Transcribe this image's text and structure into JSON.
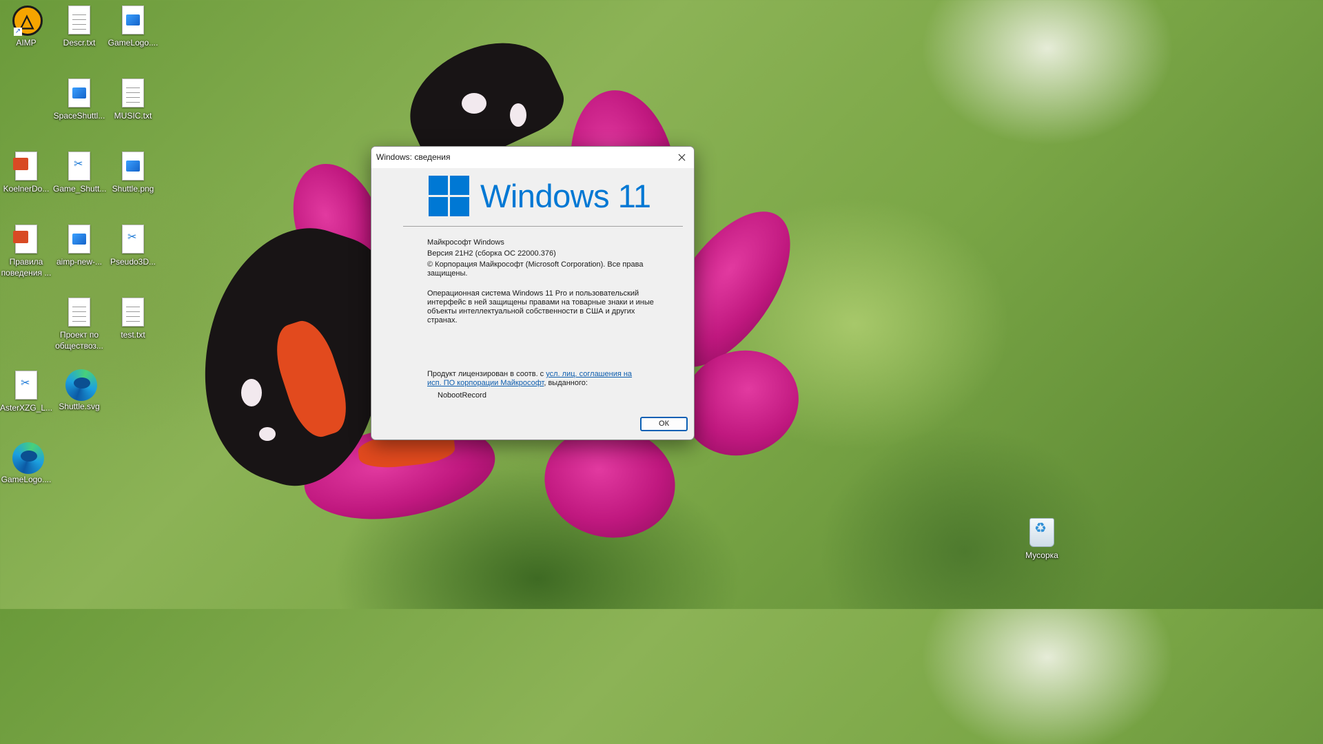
{
  "desktop": {
    "icons": [
      {
        "label": "AIMP",
        "icon": "aimp-icon"
      },
      {
        "label": "Descr.txt",
        "icon": "text-file-icon"
      },
      {
        "label": "GameLogo....",
        "icon": "image-file-icon"
      },
      {
        "label": "SpaceShuttl...",
        "icon": "image-file-icon"
      },
      {
        "label": "MUSIC.txt",
        "icon": "text-file-icon"
      },
      {
        "label": "KoelnerDo...",
        "icon": "powerpoint-file-icon"
      },
      {
        "label": "Game_Shutt...",
        "icon": "snip-file-icon"
      },
      {
        "label": "Shuttle.png",
        "icon": "image-file-icon"
      },
      {
        "label": "Правила поведения ...",
        "icon": "powerpoint-file-icon"
      },
      {
        "label": "aimp-new-...",
        "icon": "image-file-icon"
      },
      {
        "label": "Pseudo3D...",
        "icon": "snip-file-icon"
      },
      {
        "label": "Проект по обществоз...",
        "icon": "text-file-icon"
      },
      {
        "label": "test.txt",
        "icon": "text-file-icon"
      },
      {
        "label": "AsterXZG_L...",
        "icon": "snip-file-icon"
      },
      {
        "label": "Shuttle.svg",
        "icon": "edge-icon"
      },
      {
        "label": "GameLogo....",
        "icon": "edge-icon"
      },
      {
        "label": "Мусорка",
        "icon": "recycle-bin-icon"
      }
    ]
  },
  "dialog": {
    "title": "Windows: сведения",
    "logo_text": "Windows 11",
    "brand_color": "#0078d4",
    "product_name": "Майкрософт Windows",
    "version": "Версия 21H2 (сборка ОС 22000.376)",
    "copyright": "© Корпорация Майкрософт (Microsoft Corporation). Все права защищены.",
    "description": "Операционная система Windows 11 Pro и пользовательский интерфейс в ней защищены правами на товарные знаки и иные объекты интеллектуальной собственности в США и других странах.",
    "license_prefix": "Продукт лицензирован в соотв. с ",
    "license_link": "усл. лиц. соглашения на исп. ПО корпорации Майкрософт",
    "license_suffix": ", выданного:",
    "licensee": "NobootRecord",
    "ok_label": "ОК"
  }
}
